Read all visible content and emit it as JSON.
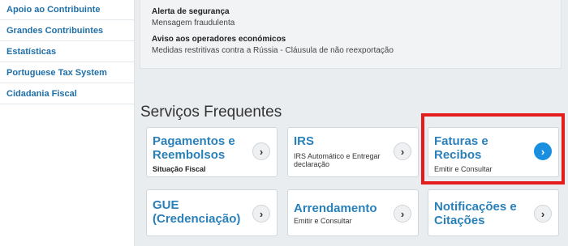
{
  "sidebar": {
    "items": [
      {
        "label": "Apoio ao Contribuinte"
      },
      {
        "label": "Grandes Contribuintes"
      },
      {
        "label": "Estatísticas"
      },
      {
        "label": "Portuguese Tax System"
      },
      {
        "label": "Cidadania Fiscal"
      }
    ]
  },
  "alerts": [
    {
      "title": "Alerta de segurança",
      "text": "Mensagem fraudulenta"
    },
    {
      "title": "Aviso aos operadores económicos",
      "text": "Medidas restritivas contra a Rússia - Cláusula de não reexportação"
    }
  ],
  "services": {
    "title": "Serviços Frequentes",
    "cards": [
      {
        "title": "Pagamentos e Reembolsos",
        "sub": "Situação Fiscal"
      },
      {
        "title": "IRS",
        "sub": "IRS Automático e Entregar declaração"
      },
      {
        "title": "Faturas e Recibos",
        "sub": "Emitir e Consultar"
      },
      {
        "title": "GUE (Credenciação)",
        "sub": ""
      },
      {
        "title": "Arrendamento",
        "sub": "Emitir e Consultar"
      },
      {
        "title": "Notificações e Citações",
        "sub": ""
      }
    ]
  },
  "icons": {
    "chevron": "chevron-right-icon"
  },
  "colors": {
    "accent": "#2a80b9",
    "highlight": "#e41c1c",
    "active_button": "#1a8fe0"
  }
}
